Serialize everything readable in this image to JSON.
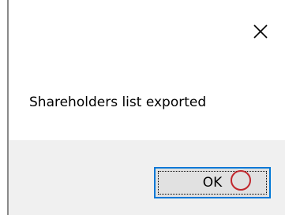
{
  "dialog": {
    "message": "Shareholders list exported",
    "ok_label": "OK",
    "close_icon": "close-icon"
  },
  "colors": {
    "footer_background": "#f0f0f0",
    "button_border_accent": "#0078d7",
    "click_marker": "#c1272d"
  }
}
